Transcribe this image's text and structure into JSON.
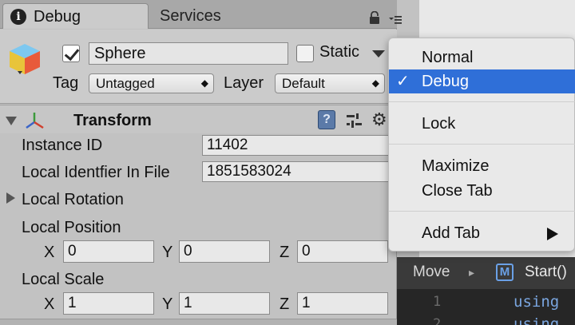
{
  "tabs": [
    {
      "label": "Debug",
      "icon": "info-icon"
    },
    {
      "label": "Services"
    }
  ],
  "gameobject": {
    "active": true,
    "name": "Sphere",
    "static_label": "Static",
    "static": false,
    "tag_label": "Tag",
    "tag_value": "Untagged",
    "layer_label": "Layer",
    "layer_value": "Default"
  },
  "transform": {
    "title": "Transform",
    "help_glyph": "?",
    "instance_id_label": "Instance ID",
    "instance_id": "11402",
    "local_id_label": "Local Identfier In File",
    "local_id": "1851583024",
    "rotation_label": "Local Rotation",
    "position_label": "Local Position",
    "position": {
      "x": "0",
      "y": "0",
      "z": "0"
    },
    "scale_label": "Local Scale",
    "scale": {
      "x": "1",
      "y": "1",
      "z": "1"
    },
    "axis_labels": {
      "x": "X",
      "y": "Y",
      "z": "Z"
    }
  },
  "context_menu": {
    "items": [
      {
        "label": "Normal",
        "checked": false
      },
      {
        "label": "Debug",
        "checked": true
      },
      {
        "label": "Lock",
        "checked": false
      },
      {
        "label": "Maximize",
        "checked": false
      },
      {
        "label": "Close Tab",
        "checked": false
      },
      {
        "label": "Add Tab",
        "submenu": true
      }
    ],
    "check_glyph": "✓",
    "selected_color": "#2f6fd8"
  },
  "editor": {
    "breadcrumb_left": "Move",
    "breadcrumb_sep": "▸",
    "method_badge": "M",
    "method": "Start()",
    "line_numbers": [
      "1",
      "2"
    ],
    "code_lines": [
      "using",
      "using"
    ]
  }
}
